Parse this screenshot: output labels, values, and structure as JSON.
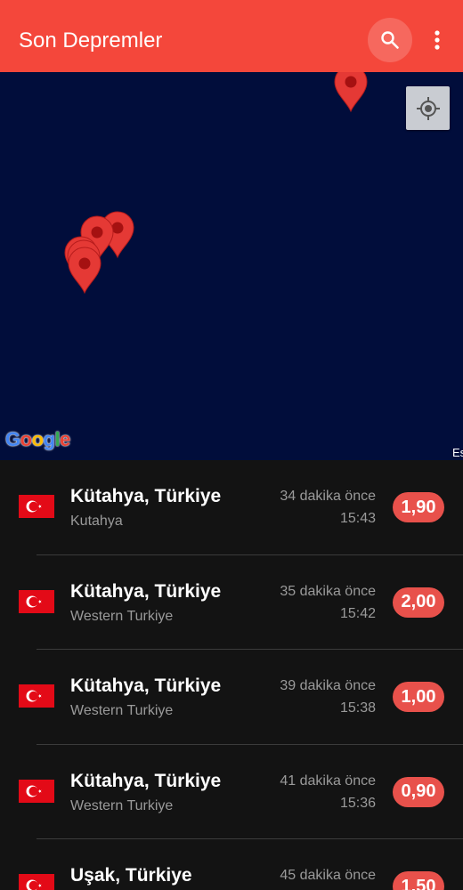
{
  "appbar": {
    "title": "Son Depremler",
    "background": "#f4473b"
  },
  "icons": {
    "search": "search-icon",
    "more": "more-vert-icon",
    "locate": "my-location-icon",
    "pin": "map-pin-icon",
    "flag": "turkey-flag-icon"
  },
  "map": {
    "background": "#010d3b",
    "logo": "Google",
    "attribution": "Es"
  },
  "colors": {
    "accent": "#f4473b",
    "magnitude_badge": "#e8514b",
    "list_background": "#131313",
    "secondary_text": "#9a9a9a"
  },
  "quakes": [
    {
      "place": "Kütahya, Türkiye",
      "region": "Kutahya",
      "ago": "34 dakika önce",
      "time": "15:43",
      "magnitude": "1,90"
    },
    {
      "place": "Kütahya, Türkiye",
      "region": "Western Turkiye",
      "ago": "35 dakika önce",
      "time": "15:42",
      "magnitude": "2,00"
    },
    {
      "place": "Kütahya, Türkiye",
      "region": "Western Turkiye",
      "ago": "39 dakika önce",
      "time": "15:38",
      "magnitude": "1,00"
    },
    {
      "place": "Kütahya, Türkiye",
      "region": "Western Turkiye",
      "ago": "41 dakika önce",
      "time": "15:36",
      "magnitude": "0,90"
    },
    {
      "place": "Uşak, Türkiye",
      "region": "",
      "ago": "45 dakika önce",
      "time": "",
      "magnitude": "1,50"
    }
  ]
}
